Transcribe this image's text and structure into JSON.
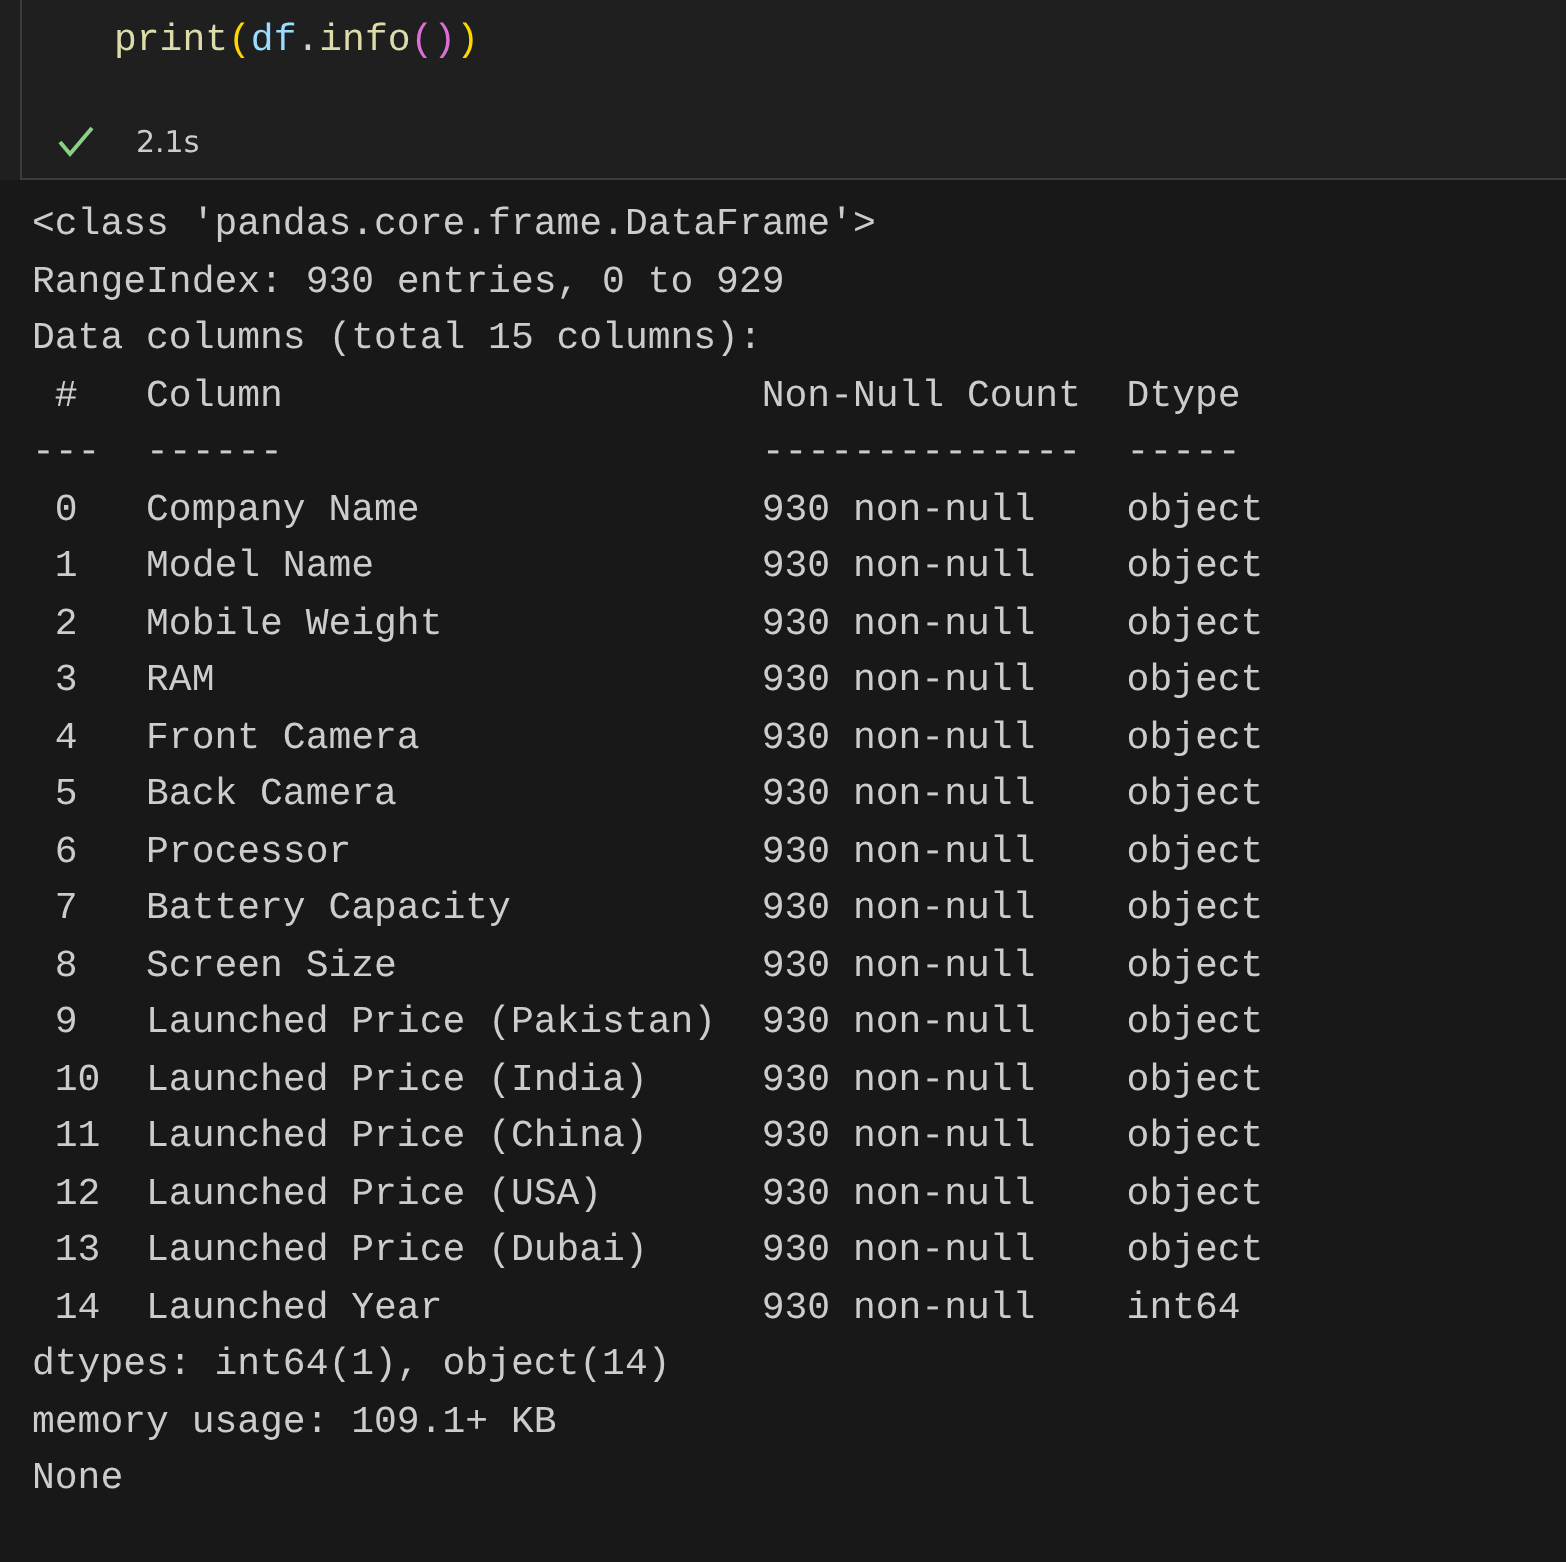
{
  "cell": {
    "code": [
      {
        "text": "print",
        "kind": "function"
      },
      {
        "text": "(",
        "kind": "bracket1"
      },
      {
        "text": "df",
        "kind": "variable"
      },
      {
        "text": ".",
        "kind": "plain"
      },
      {
        "text": "info",
        "kind": "function"
      },
      {
        "text": "(",
        "kind": "bracket2"
      },
      {
        "text": ")",
        "kind": "bracket2"
      },
      {
        "text": ")",
        "kind": "bracket1"
      }
    ],
    "status": {
      "succeeded": true,
      "time": "2.1s"
    }
  },
  "output": [
    "<class 'pandas.core.frame.DataFrame'>",
    "RangeIndex: 930 entries, 0 to 929",
    "Data columns (total 15 columns):",
    " #   Column                     Non-Null Count  Dtype ",
    "---  ------                     --------------  ----- ",
    " 0   Company Name               930 non-null    object",
    " 1   Model Name                 930 non-null    object",
    " 2   Mobile Weight              930 non-null    object",
    " 3   RAM                        930 non-null    object",
    " 4   Front Camera               930 non-null    object",
    " 5   Back Camera                930 non-null    object",
    " 6   Processor                  930 non-null    object",
    " 7   Battery Capacity           930 non-null    object",
    " 8   Screen Size                930 non-null    object",
    " 9   Launched Price (Pakistan)  930 non-null    object",
    " 10  Launched Price (India)     930 non-null    object",
    " 11  Launched Price (China)     930 non-null    object",
    " 12  Launched Price (USA)       930 non-null    object",
    " 13  Launched Price (Dubai)     930 non-null    object",
    " 14  Launched Year              930 non-null    int64 ",
    "dtypes: int64(1), object(14)",
    "memory usage: 109.1+ KB",
    "None"
  ]
}
